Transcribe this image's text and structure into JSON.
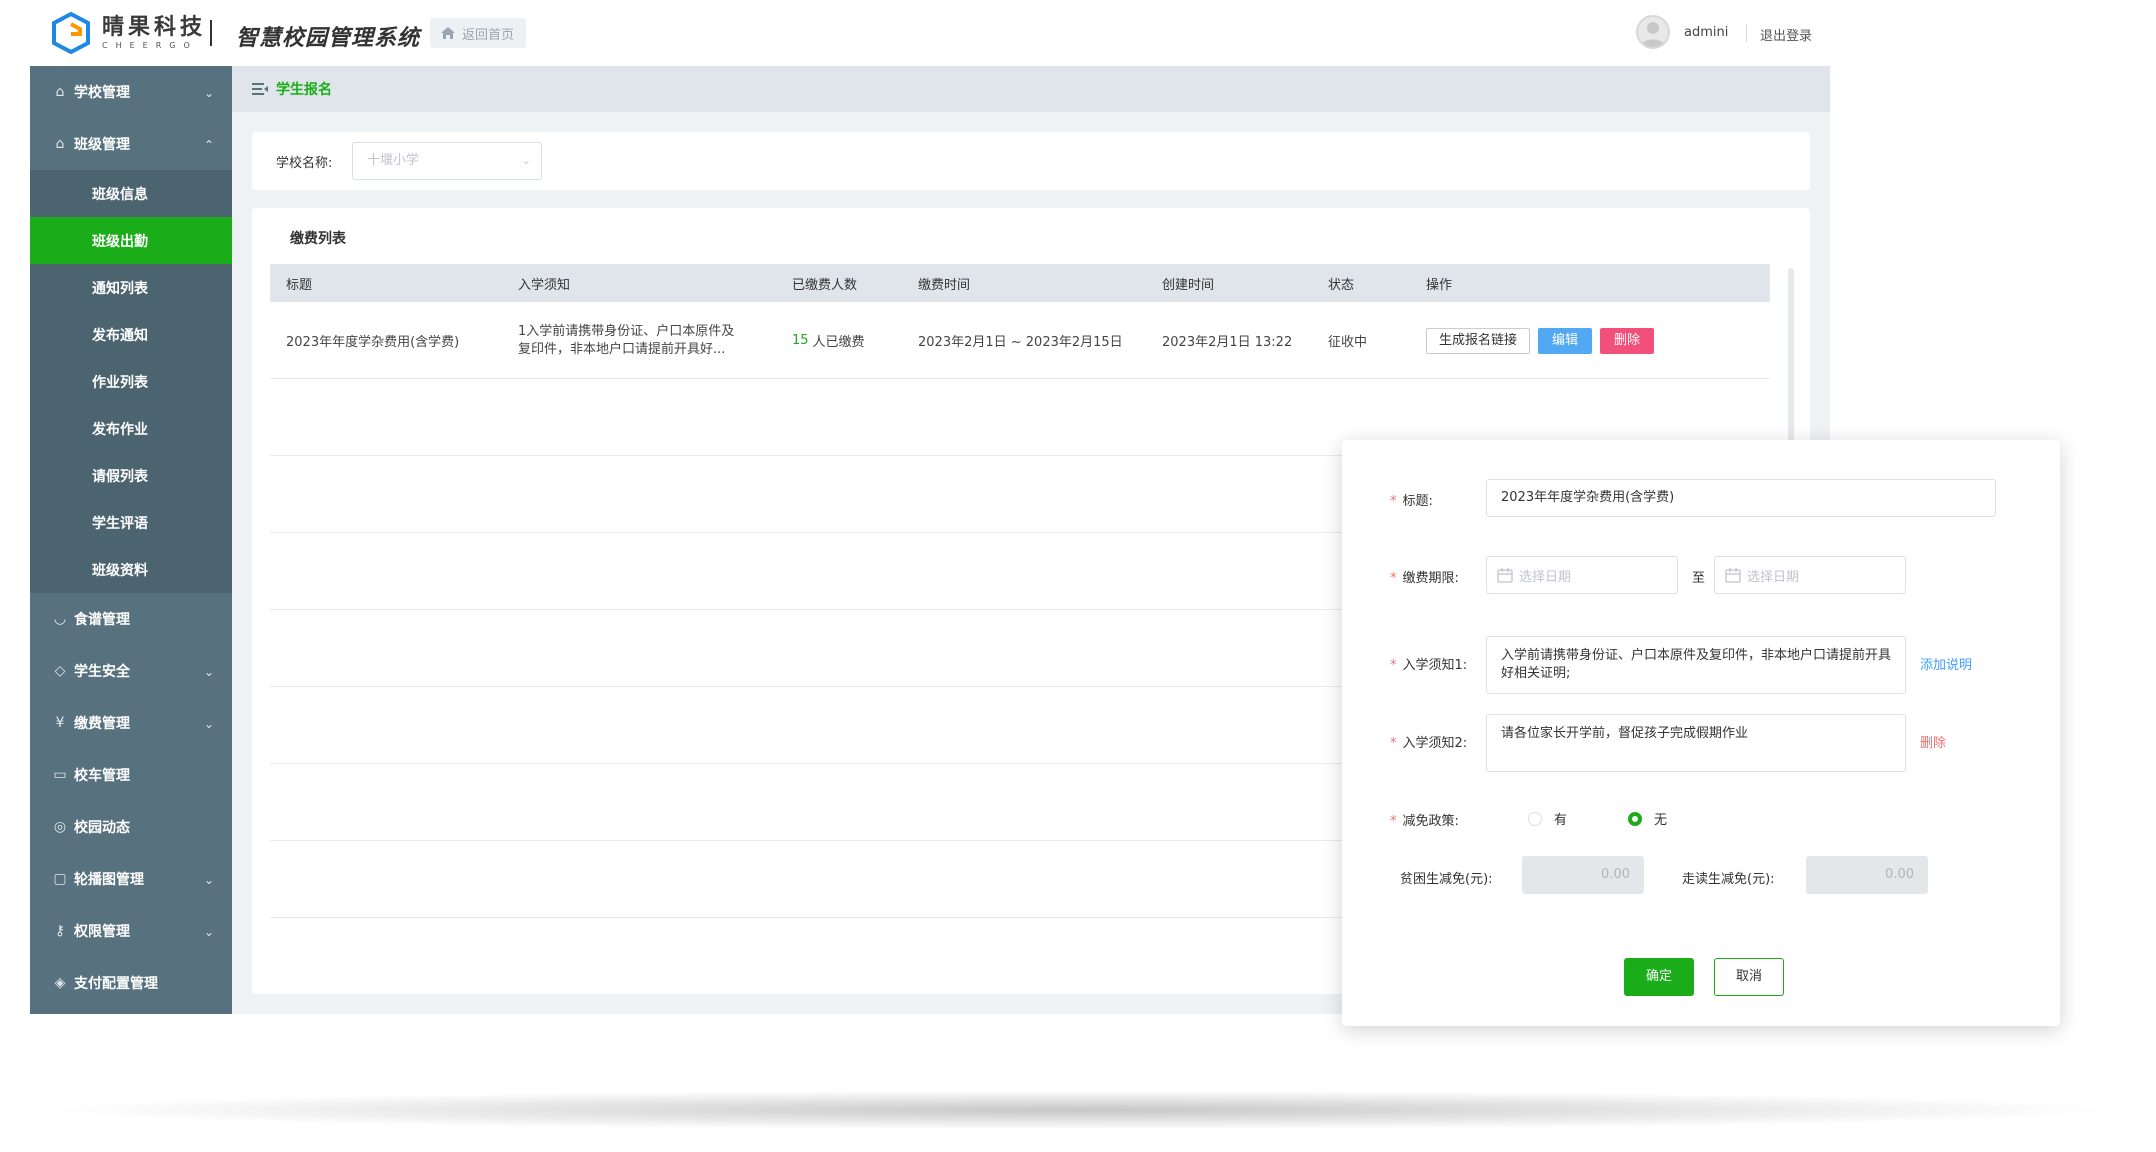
{
  "header": {
    "brand_cn": "晴果科技",
    "brand_en": "CHEERGO",
    "app_title": "智慧校园管理系统",
    "home_label": "返回首页",
    "user": "admini",
    "logout": "退出登录"
  },
  "sidebar": {
    "groups": [
      {
        "label": "学校管理",
        "icon": "school-icon",
        "expanded": false
      },
      {
        "label": "班级管理",
        "icon": "class-icon",
        "expanded": true
      },
      {
        "label": "食谱管理",
        "icon": "food-icon"
      },
      {
        "label": "学生安全",
        "icon": "shield-icon",
        "expanded": false
      },
      {
        "label": "缴费管理",
        "icon": "yuan-icon",
        "expanded": false
      },
      {
        "label": "校车管理",
        "icon": "bus-icon"
      },
      {
        "label": "校园动态",
        "icon": "dynamic-icon"
      },
      {
        "label": "轮播图管理",
        "icon": "image-icon",
        "expanded": false
      },
      {
        "label": "权限管理",
        "icon": "key-icon",
        "expanded": false
      },
      {
        "label": "支付配置管理",
        "icon": "pay-icon"
      }
    ],
    "sub_items": [
      "班级信息",
      "班级出勤",
      "通知列表",
      "发布通知",
      "作业列表",
      "发布作业",
      "请假列表",
      "学生评语",
      "班级资料"
    ],
    "active_sub": "班级出勤"
  },
  "breadcrumb": {
    "current": "学生报名"
  },
  "filter": {
    "label": "学校名称:",
    "placeholder": "十堰小学"
  },
  "list": {
    "title": "缴费列表",
    "columns": [
      "标题",
      "入学须知",
      "已缴费人数",
      "缴费时间",
      "创建时间",
      "状态",
      "操作"
    ],
    "rows": [
      {
        "title": "2023年年度学杂费用(含学费)",
        "notice_line1": "1入学前请携带身份证、户口本原件及",
        "notice_line2": "复印件，非本地户口请提前开具好...",
        "paid_count": "15",
        "paid_suffix": "人已缴费",
        "pay_time": "2023年2月1日 ~ 2023年2月15日",
        "created": "2023年2月1日 13:22",
        "status": "征收中",
        "actions": {
          "link": "生成报名链接",
          "edit": "编辑",
          "delete": "删除"
        }
      }
    ]
  },
  "modal": {
    "title_label": "标题:",
    "title_value": "2023年年度学杂费用(含学费)",
    "period_label": "缴费期限:",
    "date_placeholder": "选择日期",
    "to": "至",
    "notice1_label": "入学须知1:",
    "notice1_value": "入学前请携带身份证、户口本原件及复印件，非本地户口请提前开具好相关证明;",
    "add_note": "添加说明",
    "notice2_label": "入学须知2:",
    "notice2_value": "请各位家长开学前，督促孩子完成假期作业",
    "delete": "删除",
    "policy_label": "减免政策:",
    "policy_yes": "有",
    "policy_no": "无",
    "policy_selected": "无",
    "poor_label": "贫困生减免(元):",
    "poor_value": "0.00",
    "day_label": "走读生减免(元):",
    "day_value": "0.00",
    "confirm": "确定",
    "cancel": "取消"
  },
  "colors": {
    "accent": "#1aad19",
    "sidebar": "#57727e",
    "blue": "#52a8f2",
    "red": "#f0507a"
  }
}
